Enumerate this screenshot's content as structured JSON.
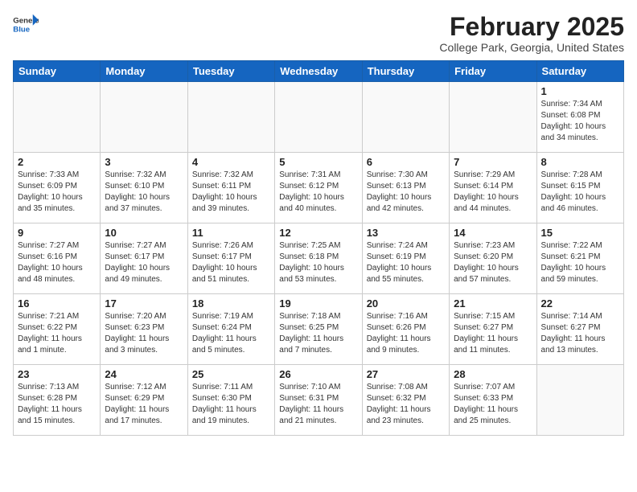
{
  "header": {
    "logo_general": "General",
    "logo_blue": "Blue",
    "month_title": "February 2025",
    "location": "College Park, Georgia, United States"
  },
  "days_of_week": [
    "Sunday",
    "Monday",
    "Tuesday",
    "Wednesday",
    "Thursday",
    "Friday",
    "Saturday"
  ],
  "weeks": [
    [
      {
        "num": "",
        "detail": ""
      },
      {
        "num": "",
        "detail": ""
      },
      {
        "num": "",
        "detail": ""
      },
      {
        "num": "",
        "detail": ""
      },
      {
        "num": "",
        "detail": ""
      },
      {
        "num": "",
        "detail": ""
      },
      {
        "num": "1",
        "detail": "Sunrise: 7:34 AM\nSunset: 6:08 PM\nDaylight: 10 hours and 34 minutes."
      }
    ],
    [
      {
        "num": "2",
        "detail": "Sunrise: 7:33 AM\nSunset: 6:09 PM\nDaylight: 10 hours and 35 minutes."
      },
      {
        "num": "3",
        "detail": "Sunrise: 7:32 AM\nSunset: 6:10 PM\nDaylight: 10 hours and 37 minutes."
      },
      {
        "num": "4",
        "detail": "Sunrise: 7:32 AM\nSunset: 6:11 PM\nDaylight: 10 hours and 39 minutes."
      },
      {
        "num": "5",
        "detail": "Sunrise: 7:31 AM\nSunset: 6:12 PM\nDaylight: 10 hours and 40 minutes."
      },
      {
        "num": "6",
        "detail": "Sunrise: 7:30 AM\nSunset: 6:13 PM\nDaylight: 10 hours and 42 minutes."
      },
      {
        "num": "7",
        "detail": "Sunrise: 7:29 AM\nSunset: 6:14 PM\nDaylight: 10 hours and 44 minutes."
      },
      {
        "num": "8",
        "detail": "Sunrise: 7:28 AM\nSunset: 6:15 PM\nDaylight: 10 hours and 46 minutes."
      }
    ],
    [
      {
        "num": "9",
        "detail": "Sunrise: 7:27 AM\nSunset: 6:16 PM\nDaylight: 10 hours and 48 minutes."
      },
      {
        "num": "10",
        "detail": "Sunrise: 7:27 AM\nSunset: 6:17 PM\nDaylight: 10 hours and 49 minutes."
      },
      {
        "num": "11",
        "detail": "Sunrise: 7:26 AM\nSunset: 6:17 PM\nDaylight: 10 hours and 51 minutes."
      },
      {
        "num": "12",
        "detail": "Sunrise: 7:25 AM\nSunset: 6:18 PM\nDaylight: 10 hours and 53 minutes."
      },
      {
        "num": "13",
        "detail": "Sunrise: 7:24 AM\nSunset: 6:19 PM\nDaylight: 10 hours and 55 minutes."
      },
      {
        "num": "14",
        "detail": "Sunrise: 7:23 AM\nSunset: 6:20 PM\nDaylight: 10 hours and 57 minutes."
      },
      {
        "num": "15",
        "detail": "Sunrise: 7:22 AM\nSunset: 6:21 PM\nDaylight: 10 hours and 59 minutes."
      }
    ],
    [
      {
        "num": "16",
        "detail": "Sunrise: 7:21 AM\nSunset: 6:22 PM\nDaylight: 11 hours and 1 minute."
      },
      {
        "num": "17",
        "detail": "Sunrise: 7:20 AM\nSunset: 6:23 PM\nDaylight: 11 hours and 3 minutes."
      },
      {
        "num": "18",
        "detail": "Sunrise: 7:19 AM\nSunset: 6:24 PM\nDaylight: 11 hours and 5 minutes."
      },
      {
        "num": "19",
        "detail": "Sunrise: 7:18 AM\nSunset: 6:25 PM\nDaylight: 11 hours and 7 minutes."
      },
      {
        "num": "20",
        "detail": "Sunrise: 7:16 AM\nSunset: 6:26 PM\nDaylight: 11 hours and 9 minutes."
      },
      {
        "num": "21",
        "detail": "Sunrise: 7:15 AM\nSunset: 6:27 PM\nDaylight: 11 hours and 11 minutes."
      },
      {
        "num": "22",
        "detail": "Sunrise: 7:14 AM\nSunset: 6:27 PM\nDaylight: 11 hours and 13 minutes."
      }
    ],
    [
      {
        "num": "23",
        "detail": "Sunrise: 7:13 AM\nSunset: 6:28 PM\nDaylight: 11 hours and 15 minutes."
      },
      {
        "num": "24",
        "detail": "Sunrise: 7:12 AM\nSunset: 6:29 PM\nDaylight: 11 hours and 17 minutes."
      },
      {
        "num": "25",
        "detail": "Sunrise: 7:11 AM\nSunset: 6:30 PM\nDaylight: 11 hours and 19 minutes."
      },
      {
        "num": "26",
        "detail": "Sunrise: 7:10 AM\nSunset: 6:31 PM\nDaylight: 11 hours and 21 minutes."
      },
      {
        "num": "27",
        "detail": "Sunrise: 7:08 AM\nSunset: 6:32 PM\nDaylight: 11 hours and 23 minutes."
      },
      {
        "num": "28",
        "detail": "Sunrise: 7:07 AM\nSunset: 6:33 PM\nDaylight: 11 hours and 25 minutes."
      },
      {
        "num": "",
        "detail": ""
      }
    ]
  ]
}
